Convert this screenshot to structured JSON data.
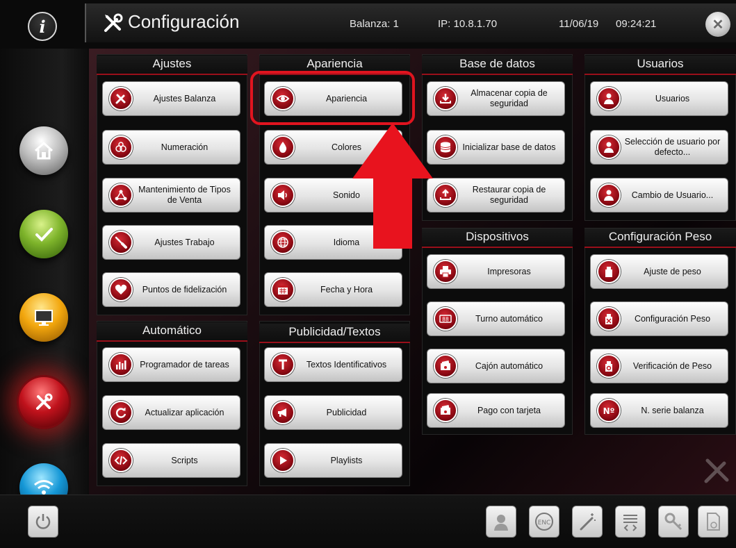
{
  "header": {
    "title": "Configuración",
    "scale_label": "Balanza:",
    "scale_value": "1",
    "ip_label": "IP:",
    "ip_value": "10.8.1.70",
    "date": "11/06/19",
    "time": "09:24:21",
    "info_symbol": "i"
  },
  "sections": {
    "ajustes": {
      "title": "Ajustes",
      "buttons": [
        "Ajustes Balanza",
        "Numeración",
        "Mantenimiento de Tipos de Venta",
        "Ajustes Trabajo",
        "Puntos de fidelización"
      ]
    },
    "apariencia": {
      "title": "Apariencia",
      "buttons": [
        "Apariencia",
        "Colores",
        "Sonido",
        "Idioma",
        "Fecha y Hora"
      ]
    },
    "base_datos": {
      "title": "Base de datos",
      "buttons": [
        "Almacenar copia de seguridad",
        "Inicializar base de datos",
        "Restaurar copia de seguridad"
      ]
    },
    "usuarios": {
      "title": "Usuarios",
      "buttons": [
        "Usuarios",
        "Selección de usuario por defecto...",
        "Cambio de Usuario..."
      ]
    },
    "dispositivos": {
      "title": "Dispositivos",
      "buttons": [
        "Impresoras",
        "Turno automático",
        "Cajón automático",
        "Pago con tarjeta"
      ]
    },
    "config_peso": {
      "title": "Configuración Peso",
      "buttons": [
        "Ajuste de peso",
        "Configuración Peso",
        "Verificación de Peso",
        "N. serie balanza"
      ]
    },
    "automatico": {
      "title": "Automático",
      "buttons": [
        "Programador de tareas",
        "Actualizar aplicación",
        "Scripts"
      ]
    },
    "publicidad": {
      "title": "Publicidad/Textos",
      "buttons": [
        "Textos Identificativos",
        "Publicidad",
        "Playlists"
      ]
    }
  },
  "nav": [
    "home",
    "check",
    "monitor",
    "settings-tools",
    "wifi"
  ],
  "bottom_icons": [
    "power",
    "support-agent",
    "enc",
    "magic-wand",
    "script-list",
    "key",
    "help-file"
  ],
  "colors": {
    "accent": "#c0121c",
    "highlight": "#e0141f",
    "bg": "#0a0a0a"
  }
}
